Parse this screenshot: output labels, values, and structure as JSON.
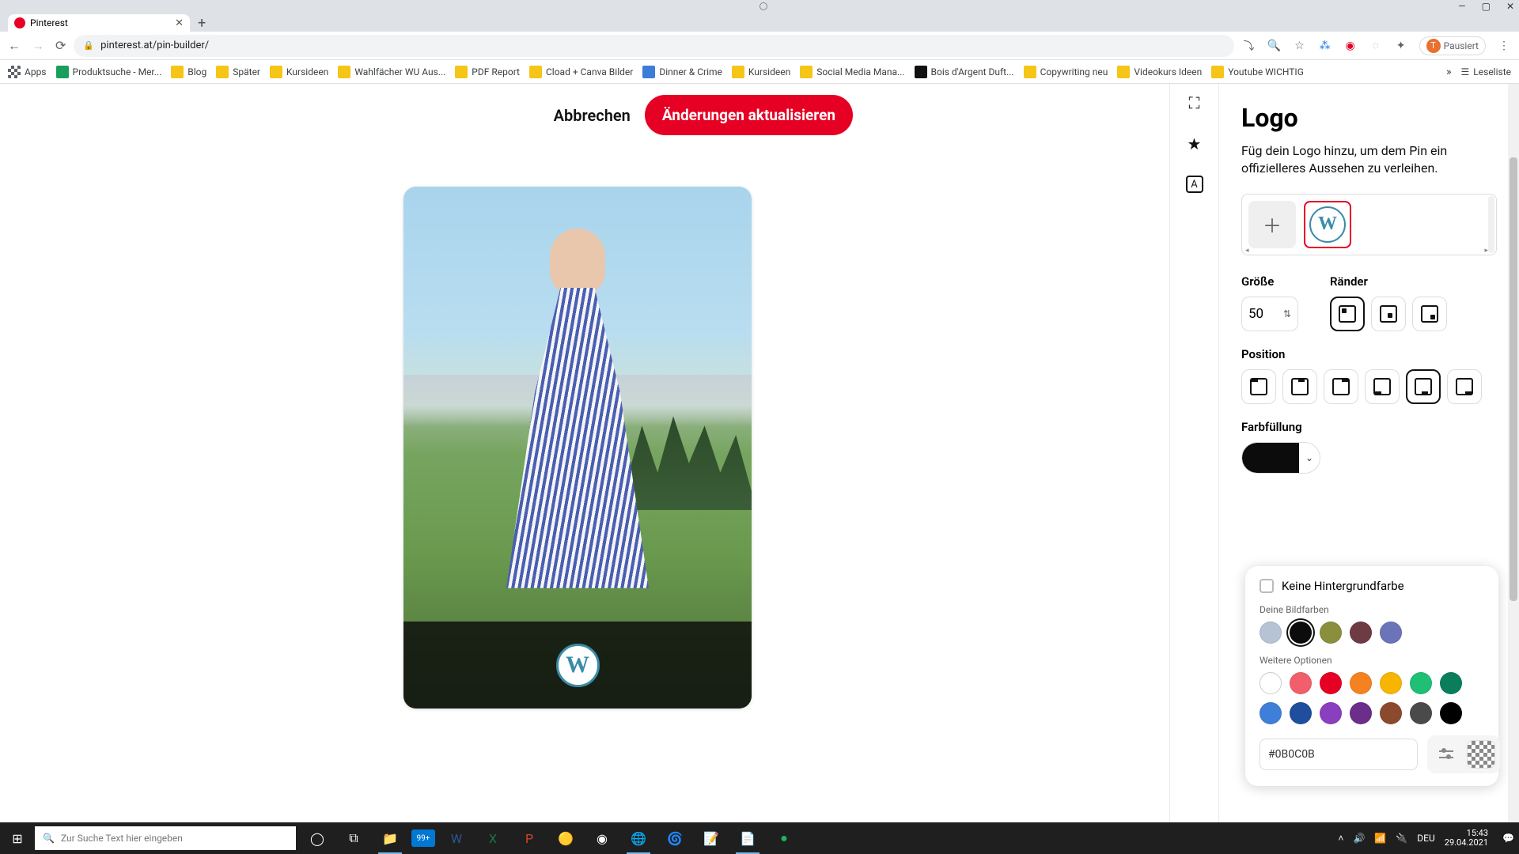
{
  "browser": {
    "tab_title": "Pinterest",
    "url": "pinterest.at/pin-builder/",
    "profile_status": "Pausiert",
    "profile_initial": "T",
    "bookmarks": [
      "Apps",
      "Produktsuche - Mer...",
      "Blog",
      "Später",
      "Kursideen",
      "Wahlfächer WU Aus...",
      "PDF Report",
      "Cload + Canva Bilder",
      "Dinner & Crime",
      "Kursideen",
      "Social Media Mana...",
      "Bois d'Argent Duft...",
      "Copywriting neu",
      "Videokurs Ideen",
      "Youtube WICHTIG"
    ],
    "reading_list": "Leseliste"
  },
  "actions": {
    "cancel": "Abbrechen",
    "update": "Änderungen aktualisieren"
  },
  "panel": {
    "title": "Logo",
    "desc": "Füg dein Logo hinzu, um dem Pin ein offizielleres Aussehen zu verleihen.",
    "size_label": "Größe",
    "size_value": "50",
    "border_label": "Ränder",
    "position_label": "Position",
    "fill_label": "Farbfüllung"
  },
  "popover": {
    "no_bg": "Keine Hintergrundfarbe",
    "your_colors": "Deine Bildfarben",
    "more_options": "Weitere Optionen",
    "hex_value": "#0B0C0B",
    "image_colors": [
      "#B6C3D4",
      "#0B0C0B",
      "#8A8F3E",
      "#6E3A44",
      "#6B74B8"
    ],
    "palette_colors": [
      "#FFFFFF",
      "#F15F6C",
      "#E60023",
      "#F58220",
      "#F7B500",
      "#1FBF75",
      "#0A7E5A",
      "#3F7FD9",
      "#1E4E9C",
      "#8A3FBF",
      "#6B2E8A",
      "#8B4A2E",
      "#4A4A4A",
      "#000000"
    ]
  },
  "pin": {
    "logo_letter": "W"
  },
  "taskbar": {
    "search_placeholder": "Zur Suche Text hier eingeben",
    "lang": "DEU",
    "time": "15:43",
    "date": "29.04.2021",
    "mail_count": "99+"
  }
}
